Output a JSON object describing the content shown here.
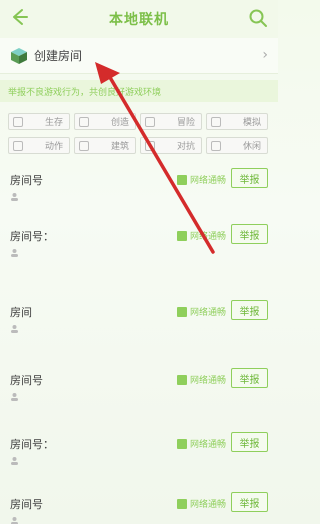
{
  "header": {
    "title": "本地联机",
    "back_icon": "back-arrow-icon",
    "search_icon": "search-icon"
  },
  "create_room": {
    "label": "创建房间",
    "icon": "cube-icon",
    "chevron_icon": "chevron-right-icon"
  },
  "notice": {
    "text": "举报不良游戏行为，共创良好游戏环境"
  },
  "filters": [
    {
      "label": "生存",
      "icon": "survival-icon"
    },
    {
      "label": "创造",
      "icon": "create-icon"
    },
    {
      "label": "冒险",
      "icon": "adventure-icon"
    },
    {
      "label": "模拟",
      "icon": "simulate-icon"
    },
    {
      "label": "动作",
      "icon": "action-icon"
    },
    {
      "label": "建筑",
      "icon": "building-icon"
    },
    {
      "label": "对抗",
      "icon": "versus-icon"
    },
    {
      "label": "休闲",
      "icon": "casual-icon"
    }
  ],
  "rooms": [
    {
      "name": "房间号",
      "network": "网络通畅",
      "report": "举报"
    },
    {
      "name": "房间号：",
      "network": "网络通畅",
      "report": "举报"
    },
    {
      "name": "房间",
      "network": "网络通畅",
      "report": "举报"
    },
    {
      "name": "房间号",
      "network": "网络通畅",
      "report": "举报"
    },
    {
      "name": "房间号：",
      "network": "网络通畅",
      "report": "举报"
    },
    {
      "name": "房间号",
      "network": "网络通畅",
      "report": "举报"
    }
  ],
  "colors": {
    "accent": "#86c554",
    "annotation": "#d42b2b"
  }
}
